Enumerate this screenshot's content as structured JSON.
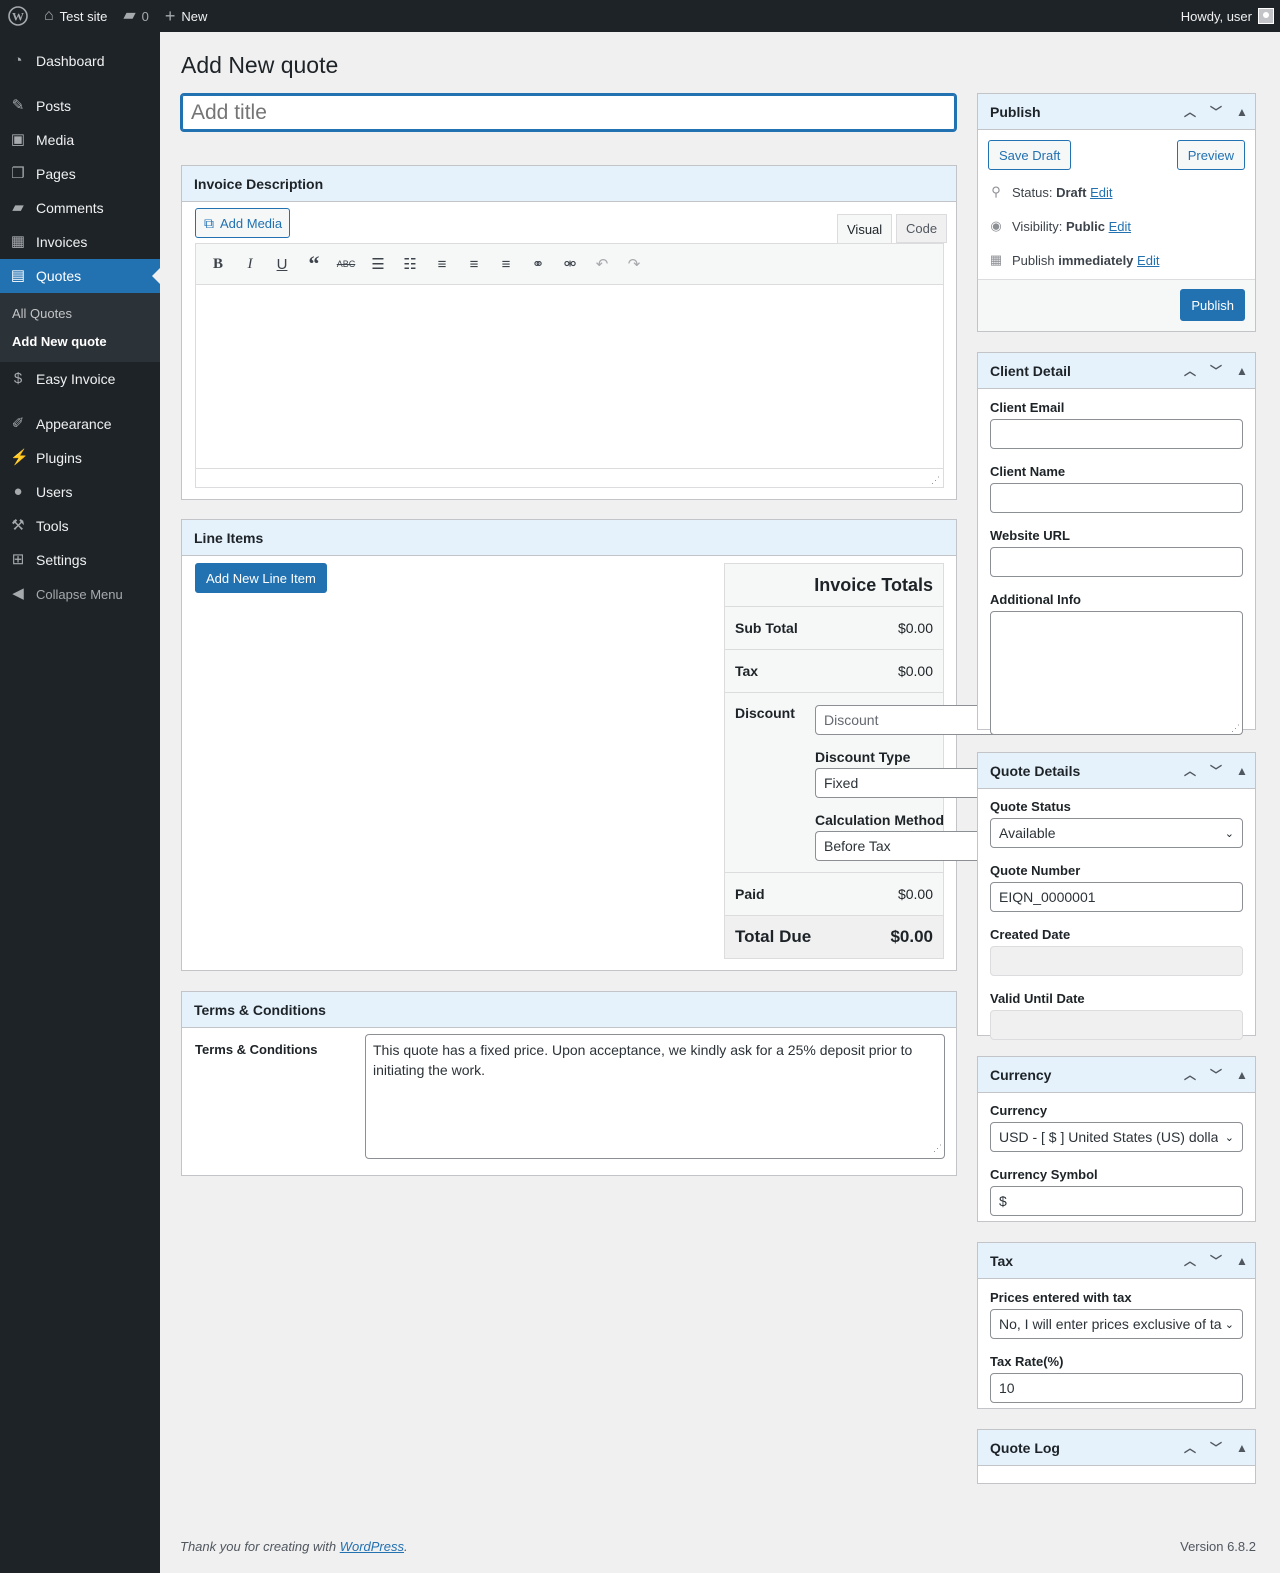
{
  "adminbar": {
    "site_name": "Test site",
    "comments_count": "0",
    "new_label": "New",
    "howdy": "Howdy, user"
  },
  "sidebar": {
    "items": [
      {
        "label": "Dashboard",
        "icon": "dashboard-icon"
      },
      {
        "label": "Posts",
        "icon": "pin-icon"
      },
      {
        "label": "Media",
        "icon": "media-icon"
      },
      {
        "label": "Pages",
        "icon": "pages-icon"
      },
      {
        "label": "Comments",
        "icon": "comment-icon"
      },
      {
        "label": "Invoices",
        "icon": "calculator-icon"
      },
      {
        "label": "Quotes",
        "icon": "document-icon"
      },
      {
        "label": "Easy Invoice",
        "icon": "dollar-icon"
      },
      {
        "label": "Appearance",
        "icon": "brush-icon"
      },
      {
        "label": "Plugins",
        "icon": "plugin-icon"
      },
      {
        "label": "Users",
        "icon": "user-icon"
      },
      {
        "label": "Tools",
        "icon": "wrench-icon"
      },
      {
        "label": "Settings",
        "icon": "settings-icon"
      }
    ],
    "submenu": {
      "all_quotes": "All Quotes",
      "add_new": "Add New quote"
    },
    "collapse": "Collapse Menu"
  },
  "page": {
    "title": "Add New quote",
    "title_placeholder": "Add title"
  },
  "description_box": {
    "title": "Invoice Description",
    "add_media": "Add Media",
    "tab_visual": "Visual",
    "tab_code": "Code"
  },
  "line_items": {
    "title": "Line Items",
    "add_button": "Add New Line Item",
    "totals": {
      "heading": "Invoice Totals",
      "subtotal_label": "Sub Total",
      "subtotal_value": "$0.00",
      "tax_label": "Tax",
      "tax_value": "$0.00",
      "discount_label": "Discount",
      "discount_placeholder": "Discount",
      "discount_type_label": "Discount Type",
      "discount_type_value": "Fixed",
      "calc_method_label": "Calculation Method",
      "calc_method_value": "Before Tax",
      "paid_label": "Paid",
      "paid_value": "$0.00",
      "total_label": "Total Due",
      "total_value": "$0.00"
    }
  },
  "terms": {
    "title": "Terms & Conditions",
    "label": "Terms & Conditions",
    "text": "This quote has a fixed price. Upon acceptance, we kindly ask for a 25% deposit prior to initiating the work."
  },
  "publish": {
    "title": "Publish",
    "save_draft": "Save Draft",
    "preview": "Preview",
    "status_label": "Status:",
    "status_value": "Draft",
    "visibility_label": "Visibility:",
    "visibility_value": "Public",
    "publish_label": "Publish",
    "publish_value": "immediately",
    "edit": "Edit",
    "publish_button": "Publish"
  },
  "client": {
    "title": "Client Detail",
    "email_label": "Client Email",
    "name_label": "Client Name",
    "website_label": "Website URL",
    "info_label": "Additional Info"
  },
  "quote_details": {
    "title": "Quote Details",
    "status_label": "Quote Status",
    "status_value": "Available",
    "number_label": "Quote Number",
    "number_value": "EIQN_0000001",
    "created_label": "Created Date",
    "valid_label": "Valid Until Date"
  },
  "currency": {
    "title": "Currency",
    "currency_label": "Currency",
    "currency_value": "USD - [ $ ] United States (US) dolla",
    "symbol_label": "Currency Symbol",
    "symbol_value": "$"
  },
  "tax": {
    "title": "Tax",
    "prices_label": "Prices entered with tax",
    "prices_value": "No, I will enter prices exclusive of ta",
    "rate_label": "Tax Rate(%)",
    "rate_value": "10"
  },
  "quote_log": {
    "title": "Quote Log"
  },
  "footer": {
    "thanks_prefix": "Thank you for creating with ",
    "wordpress": "WordPress",
    "thanks_suffix": ".",
    "version": "Version 6.8.2"
  },
  "colors": {
    "accent": "#2271b1",
    "sidebar_bg": "#1d2327",
    "header_bg": "#e5f2fc"
  }
}
